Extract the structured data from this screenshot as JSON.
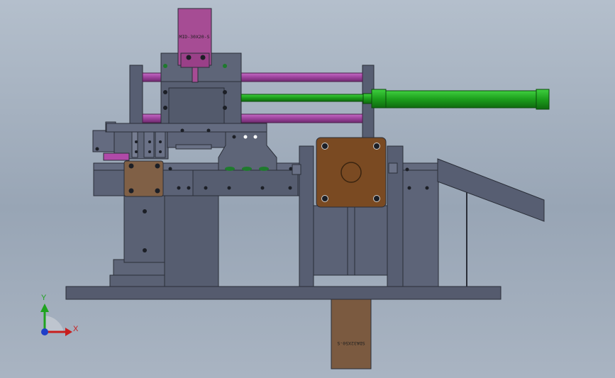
{
  "model": {
    "top_cylinder_label": "MID-30X20-S",
    "bottom_cylinder_label": "SDA32X50-S"
  },
  "triad": {
    "x_label": "X",
    "y_label": "Y"
  },
  "colors": {
    "steel": "#575e72",
    "steel_dark": "#3f4556",
    "steel_light": "#6a7186",
    "rod_purple": "#a64aa6",
    "rod_green": "#1fa31f",
    "motor_brown": "#7a4a22",
    "block_brown": "#805c42",
    "cylinder_purple": "#a64c94"
  }
}
